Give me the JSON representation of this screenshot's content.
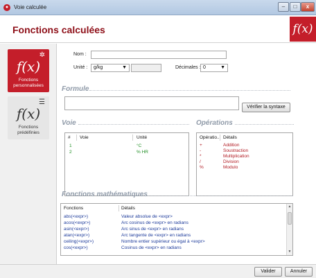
{
  "window": {
    "title": "Voie calculée",
    "app_icon": "app-logo-icon",
    "min_glyph": "–",
    "max_glyph": "□",
    "close_glyph": "x"
  },
  "header": {
    "title": "Fonctions calculées",
    "logo": "f(x)"
  },
  "nav": {
    "items": [
      {
        "glyph": "f(x)",
        "badge": "✲",
        "label": "Fonctions personnalisées",
        "active": true
      },
      {
        "glyph": "f(x)",
        "badge": "☰",
        "label": "Fonctions prédéfinies",
        "active": false
      }
    ]
  },
  "form": {
    "name_label": "Nom :",
    "name_value": "",
    "unit_label": "Unité :",
    "unit_value": "g/kg",
    "unit_extra_value": "",
    "decimals_label": "Décimales :",
    "decimals_value": "0"
  },
  "formule": {
    "title": "Formule",
    "value": "",
    "verify_button": "Vérifier la syntaxe"
  },
  "voie": {
    "title": "Voie",
    "columns": [
      "#",
      "Voie",
      "Unité"
    ],
    "rows": [
      {
        "num": "1",
        "voie": "",
        "unite": "°C"
      },
      {
        "num": "2",
        "voie": "",
        "unite": "% HR"
      }
    ]
  },
  "operations": {
    "title": "Opérations",
    "columns": [
      "Opératio...",
      "Détails"
    ],
    "rows": [
      {
        "op": "+",
        "detail": "Addition"
      },
      {
        "op": "-",
        "detail": "Soustraction"
      },
      {
        "op": "*",
        "detail": "Multiplication"
      },
      {
        "op": "/",
        "detail": "Division"
      },
      {
        "op": "%",
        "detail": "Modulo"
      }
    ]
  },
  "math": {
    "title": "Fonctions mathématiques",
    "columns": [
      "Fonctions",
      "Détails"
    ],
    "rows": [
      {
        "fn": "abs(<expr>)",
        "detail": "Valeur absolue de <expr>"
      },
      {
        "fn": "acos(<expr>)",
        "detail": "Arc cosinus de <expr> en radians"
      },
      {
        "fn": "asin(<expr>)",
        "detail": "Arc sinus de <expr> en radians"
      },
      {
        "fn": "atan(<expr>)",
        "detail": "Arc tangente de <expr> en radians"
      },
      {
        "fn": "ceiling(<expr>)",
        "detail": "Nombre entier supérieur ou égal à <expr>"
      },
      {
        "fn": "cos(<expr>)",
        "detail": "Cosinus de <expr> en radians"
      }
    ]
  },
  "footer": {
    "ok_button": "Valider",
    "cancel_button": "Annuler"
  },
  "colors": {
    "brand_red": "#c41e2a",
    "title_red": "#8e0f18",
    "section_gray": "#8f9aa8",
    "green": "#1d8d22",
    "link_blue": "#1c3a9a"
  }
}
